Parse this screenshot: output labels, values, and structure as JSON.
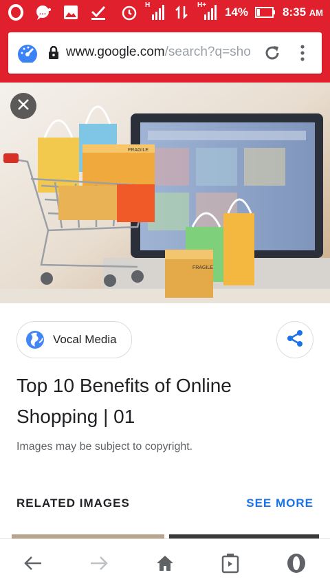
{
  "status_bar": {
    "battery": "14%",
    "time": "8:35",
    "ampm": "AM",
    "network1": "H",
    "network2": "H+",
    "icons": [
      "opera-icon",
      "chat-alert-icon",
      "gallery-icon",
      "check-icon",
      "alarm-icon",
      "signal-icon",
      "data-transfer-icon",
      "signal-icon",
      "battery-icon"
    ]
  },
  "browser": {
    "url_host": "www.google.com",
    "url_path": "/search?q=sho",
    "icons": [
      "speed-dial-icon",
      "lock-icon",
      "reload-icon",
      "overflow-menu-icon"
    ]
  },
  "image_viewer": {
    "close_icon": "close-icon",
    "source": "Vocal Media",
    "title": "Top 10 Benefits of Online Shopping | 01",
    "copyright_notice": "Images may be subject to copyright.",
    "related_heading": "RELATED IMAGES",
    "see_more": "SEE MORE",
    "fragile_label": "FRAGILE"
  },
  "bottom_nav": {
    "icons": [
      "back-icon",
      "forward-icon",
      "home-icon",
      "tabs-icon",
      "opera-menu-icon"
    ]
  },
  "colors": {
    "brand_red": "#e0202c",
    "link_blue": "#1a73e8"
  }
}
